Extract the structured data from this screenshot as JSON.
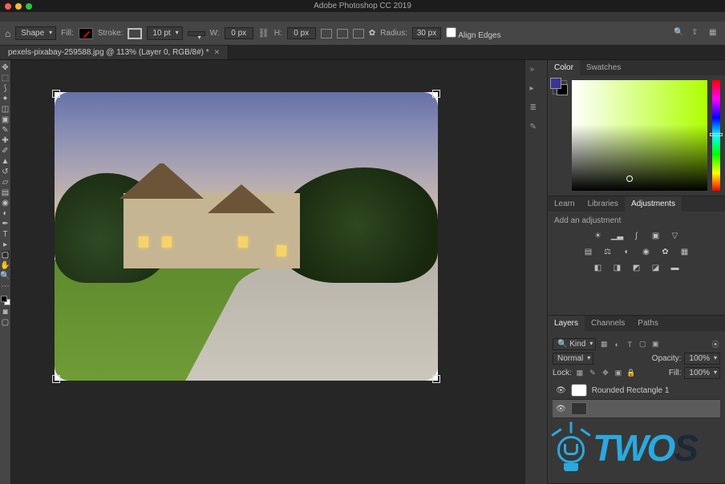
{
  "app_title": "Adobe Photoshop CC 2019",
  "options_bar": {
    "shape_tool_label": "Shape",
    "fill_label": "Fill:",
    "stroke_label": "Stroke:",
    "stroke_width": "10 pt",
    "width_label": "W:",
    "width_value": "0 px",
    "height_label": "H:",
    "height_value": "0 px",
    "radius_label": "Radius:",
    "radius_value": "30 px",
    "align_edges_label": "Align Edges"
  },
  "document_tab": "pexels-pixabay-259588.jpg @ 113% (Layer 0, RGB/8#) *",
  "panels": {
    "color_tab": "Color",
    "swatches_tab": "Swatches",
    "learn_tab": "Learn",
    "libraries_tab": "Libraries",
    "adjustments_tab": "Adjustments",
    "add_adjustment_label": "Add an adjustment",
    "layers_tab": "Layers",
    "channels_tab": "Channels",
    "paths_tab": "Paths"
  },
  "layers": {
    "filter_label": "Kind",
    "blend_mode": "Normal",
    "opacity_label": "Opacity:",
    "opacity_value": "100%",
    "lock_label": "Lock:",
    "fill_label": "Fill:",
    "fill_value": "100%",
    "items": [
      {
        "name": "Rounded Rectangle 1",
        "visible": true,
        "selected": false
      },
      {
        "name": "",
        "visible": true,
        "selected": true
      }
    ]
  },
  "watermark": {
    "text_a": "TWO",
    "text_b": "S"
  },
  "colors": {
    "accent": "#2aa9e0",
    "foreground": "#3c3392",
    "picker_hue": "#aeff00"
  }
}
